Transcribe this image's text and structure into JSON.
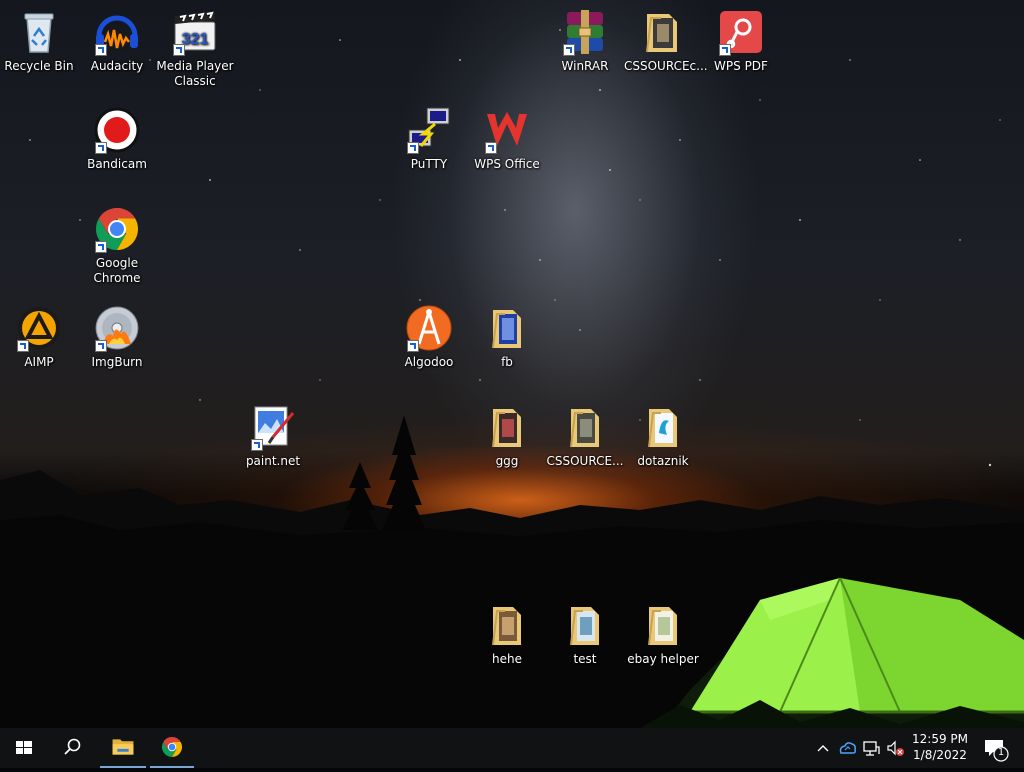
{
  "desktop": {
    "icons": [
      {
        "id": "recycle-bin",
        "label": "Recycle Bin",
        "icon": "recycle-bin-icon",
        "shortcut": false
      },
      {
        "id": "audacity",
        "label": "Audacity",
        "icon": "audacity-icon",
        "shortcut": true
      },
      {
        "id": "media-player-classic",
        "label": "Media Player Classic",
        "icon": "media-player-classic-icon",
        "shortcut": true
      },
      {
        "id": "winrar",
        "label": "WinRAR",
        "icon": "winrar-icon",
        "shortcut": true
      },
      {
        "id": "cssource-c",
        "label": "CSSOURCEc...",
        "icon": "folder-icon",
        "shortcut": false
      },
      {
        "id": "wps-pdf",
        "label": "WPS PDF",
        "icon": "wps-pdf-icon",
        "shortcut": true
      },
      {
        "id": "bandicam",
        "label": "Bandicam",
        "icon": "bandicam-icon",
        "shortcut": true
      },
      {
        "id": "putty",
        "label": "PuTTY",
        "icon": "putty-icon",
        "shortcut": true
      },
      {
        "id": "wps-office",
        "label": "WPS Office",
        "icon": "wps-office-icon",
        "shortcut": true
      },
      {
        "id": "google-chrome",
        "label": "Google Chrome",
        "icon": "chrome-icon",
        "shortcut": true
      },
      {
        "id": "aimp",
        "label": "AIMP",
        "icon": "aimp-icon",
        "shortcut": true
      },
      {
        "id": "imgburn",
        "label": "ImgBurn",
        "icon": "imgburn-icon",
        "shortcut": true
      },
      {
        "id": "algodoo",
        "label": "Algodoo",
        "icon": "algodoo-icon",
        "shortcut": true
      },
      {
        "id": "fb",
        "label": "fb",
        "icon": "folder-icon",
        "shortcut": false
      },
      {
        "id": "paint-net",
        "label": "paint.net",
        "icon": "paint-net-icon",
        "shortcut": true
      },
      {
        "id": "ggg",
        "label": "ggg",
        "icon": "folder-icon",
        "shortcut": false
      },
      {
        "id": "cssource-2",
        "label": "CSSOURCE...",
        "icon": "folder-icon",
        "shortcut": false
      },
      {
        "id": "dotaznik",
        "label": "dotaznik",
        "icon": "folder-icon",
        "shortcut": false
      },
      {
        "id": "hehe",
        "label": "hehe",
        "icon": "folder-icon",
        "shortcut": false
      },
      {
        "id": "test",
        "label": "test",
        "icon": "folder-icon",
        "shortcut": false
      },
      {
        "id": "ebay-helper",
        "label": "ebay helper",
        "icon": "folder-icon",
        "shortcut": false
      }
    ]
  },
  "taskbar": {
    "start_icon": "windows-start-icon",
    "search_icon": "search-icon",
    "pinned": [
      {
        "name": "file-explorer",
        "icon": "file-explorer-icon",
        "active": true
      },
      {
        "name": "google-chrome",
        "icon": "chrome-icon",
        "active": true
      }
    ],
    "tray": {
      "time": "12:59 PM",
      "date": "1/8/2022",
      "notification_count": "1"
    }
  },
  "colors": {
    "taskbar_bg": "#101214",
    "tent_green": "#8ee63a",
    "horizon_orange": "#ff7a1e"
  }
}
